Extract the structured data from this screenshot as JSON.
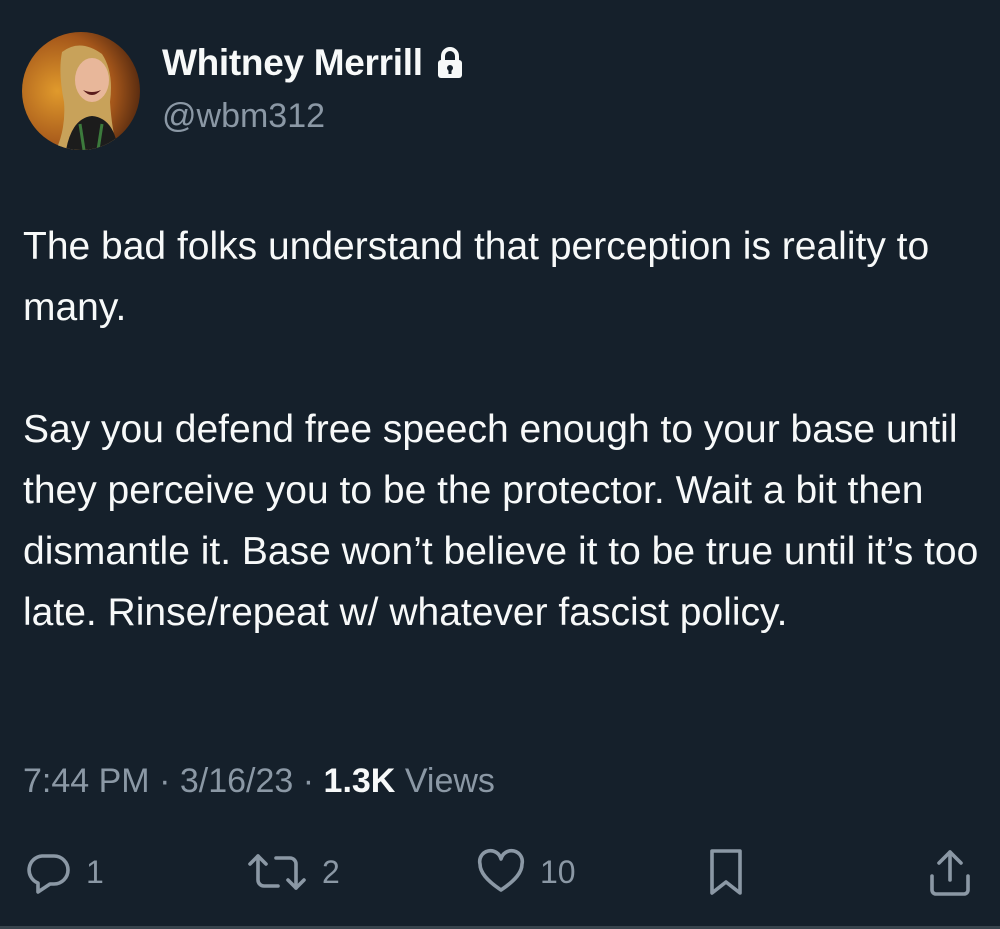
{
  "author": {
    "display_name": "Whitney Merrill",
    "handle": "@wbm312",
    "protected_icon": "lock-icon"
  },
  "tweet": {
    "paragraphs": [
      "The bad folks understand that perception is reality to many.",
      "Say you defend free speech enough to your base until they perceive you to be the protector. Wait a bit then dismantle it. Base won’t believe it to be true until it’s too late. Rinse/repeat w/ whatever fascist policy."
    ],
    "time": "7:44 PM",
    "separator": "·",
    "date": "3/16/23",
    "views_count": "1.3K",
    "views_label": "Views"
  },
  "actions": {
    "reply": {
      "icon": "reply-icon",
      "count": "1"
    },
    "retweet": {
      "icon": "retweet-icon",
      "count": "2"
    },
    "like": {
      "icon": "heart-icon",
      "count": "10"
    },
    "bookmark": {
      "icon": "bookmark-icon"
    },
    "share": {
      "icon": "share-icon"
    }
  },
  "colors": {
    "background": "#15202b",
    "primary_text": "#f7f9f9",
    "secondary_text": "#8b98a5"
  }
}
